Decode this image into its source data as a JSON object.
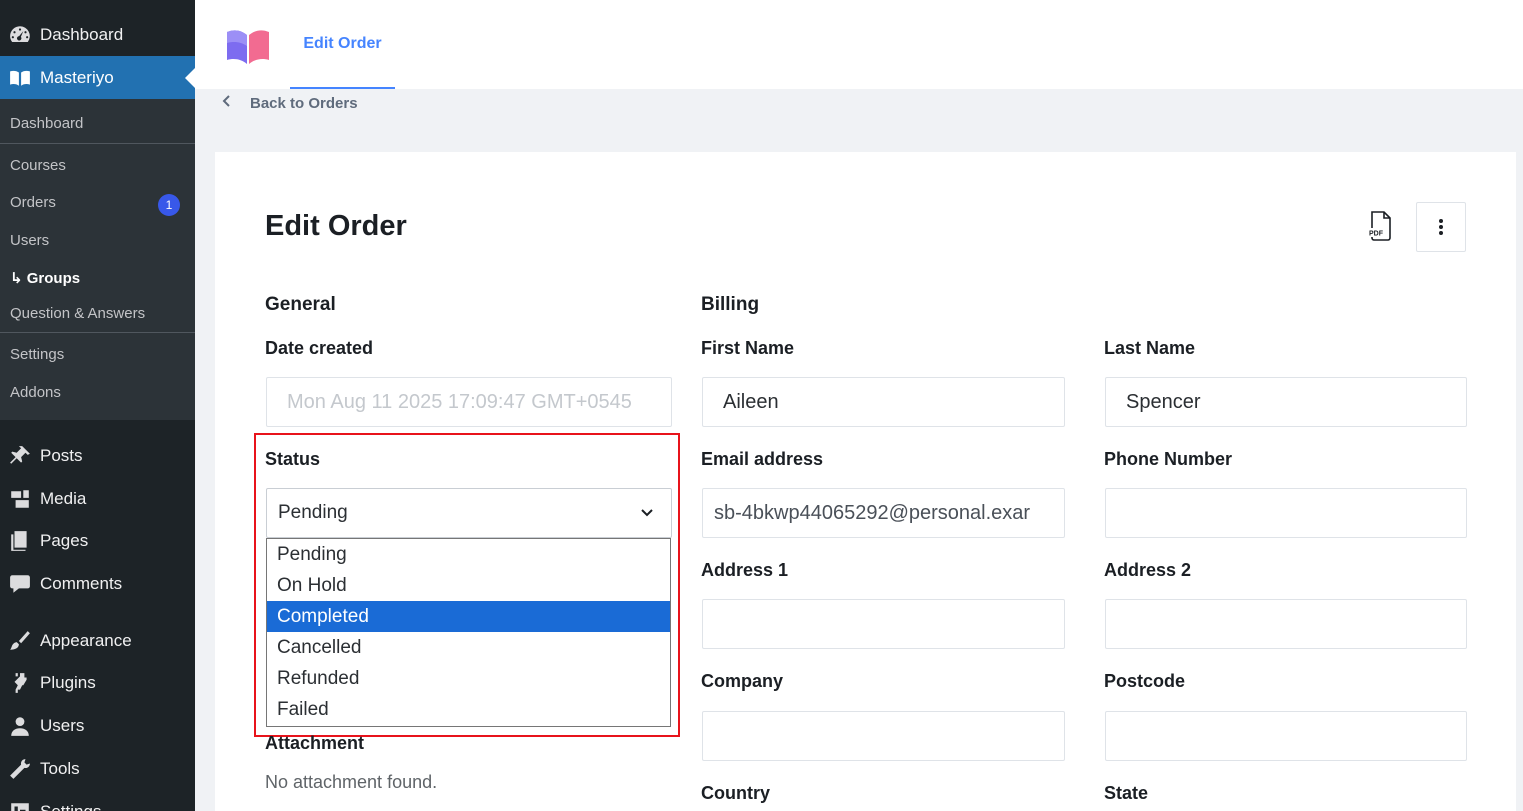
{
  "sidebar": {
    "top_items": [
      {
        "label": "Dashboard",
        "icon": "dashboard-icon"
      },
      {
        "label": "Masteriyo",
        "icon": "book-icon"
      }
    ],
    "submenu": [
      {
        "label": "Dashboard"
      },
      {
        "label": "Courses"
      },
      {
        "label": "Orders",
        "badge": "1"
      },
      {
        "label": "Users"
      },
      {
        "label": "Groups",
        "prefix": "↳"
      },
      {
        "label": "Question & Answers"
      },
      {
        "label": "Settings"
      },
      {
        "label": "Addons"
      }
    ],
    "bottom_items": [
      {
        "label": "Posts",
        "icon": "pin-icon"
      },
      {
        "label": "Media",
        "icon": "media-icon"
      },
      {
        "label": "Pages",
        "icon": "pages-icon"
      },
      {
        "label": "Comments",
        "icon": "comment-icon"
      },
      {
        "label": "Appearance",
        "icon": "brush-icon"
      },
      {
        "label": "Plugins",
        "icon": "plugin-icon"
      },
      {
        "label": "Users",
        "icon": "user-icon"
      },
      {
        "label": "Tools",
        "icon": "wrench-icon"
      },
      {
        "label": "Settings",
        "icon": "settings-icon"
      }
    ]
  },
  "header": {
    "tab_label": "Edit Order",
    "back_link": "Back to Orders"
  },
  "main": {
    "title": "Edit Order",
    "pdf_icon_text": "PDF",
    "general": {
      "heading": "General",
      "date_label": "Date created",
      "date_value": "Mon Aug 11 2025 17:09:47 GMT+0545",
      "status_label": "Status",
      "status_value": "Pending",
      "status_options": [
        "Pending",
        "On Hold",
        "Completed",
        "Cancelled",
        "Refunded",
        "Failed"
      ],
      "status_highlighted": "Completed",
      "attachment_label": "Attachment",
      "attachment_value": "No attachment found."
    },
    "billing": {
      "heading": "Billing",
      "first_name_label": "First Name",
      "first_name_value": "Aileen",
      "last_name_label": "Last Name",
      "last_name_value": "Spencer",
      "email_label": "Email address",
      "email_value": "sb-4bkwp44065292@personal.exar",
      "phone_label": "Phone Number",
      "phone_value": "",
      "address1_label": "Address 1",
      "address2_label": "Address 2",
      "company_label": "Company",
      "postcode_label": "Postcode",
      "country_label": "Country",
      "state_label": "State"
    }
  },
  "colors": {
    "sidebar_bg": "#1d2327",
    "submenu_bg": "#2c3338",
    "accent": "#2271b1",
    "tab_blue": "#4584ff",
    "highlight_red": "#e8131b",
    "option_highlight": "#1a6bd6"
  }
}
